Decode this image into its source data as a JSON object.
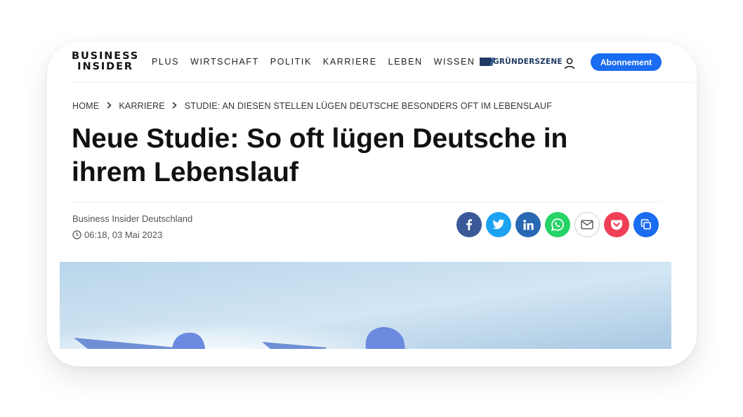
{
  "header": {
    "logo_line1": "BUSINESS",
    "logo_line2": "INSIDER",
    "nav": [
      "PLUS",
      "WIRTSCHAFT",
      "POLITIK",
      "KARRIERE",
      "LEBEN",
      "WISSEN"
    ],
    "partner": "GRÜNDERSZENE",
    "subscribe_label": "Abonnement"
  },
  "breadcrumb": [
    "HOME",
    "KARRIERE",
    "STUDIE: AN DIESEN STELLEN LÜGEN DEUTSCHE BESONDERS OFT IM LEBENSLAUF"
  ],
  "article": {
    "title": "Neue Studie: So oft lügen Deutsche in ihrem Lebenslauf",
    "author": "Business Insider Deutschland",
    "date": "06:18, 03 Mai 2023"
  },
  "share": [
    {
      "name": "facebook",
      "icon": "facebook-icon",
      "color": "#3b5998"
    },
    {
      "name": "twitter",
      "icon": "twitter-icon",
      "color": "#1da1f2"
    },
    {
      "name": "linkedin",
      "icon": "linkedin-icon",
      "color": "#0a66c2"
    },
    {
      "name": "whatsapp",
      "icon": "whatsapp-icon",
      "color": "#25d366"
    },
    {
      "name": "email",
      "icon": "mail-icon",
      "color": "#ffffff"
    },
    {
      "name": "pocket",
      "icon": "pocket-icon",
      "color": "#ef3f56"
    },
    {
      "name": "copy",
      "icon": "copy-icon",
      "color": "#1a6cf0"
    }
  ],
  "colors": {
    "accent": "#1a6cf0",
    "text": "#111111",
    "muted": "#555555"
  }
}
